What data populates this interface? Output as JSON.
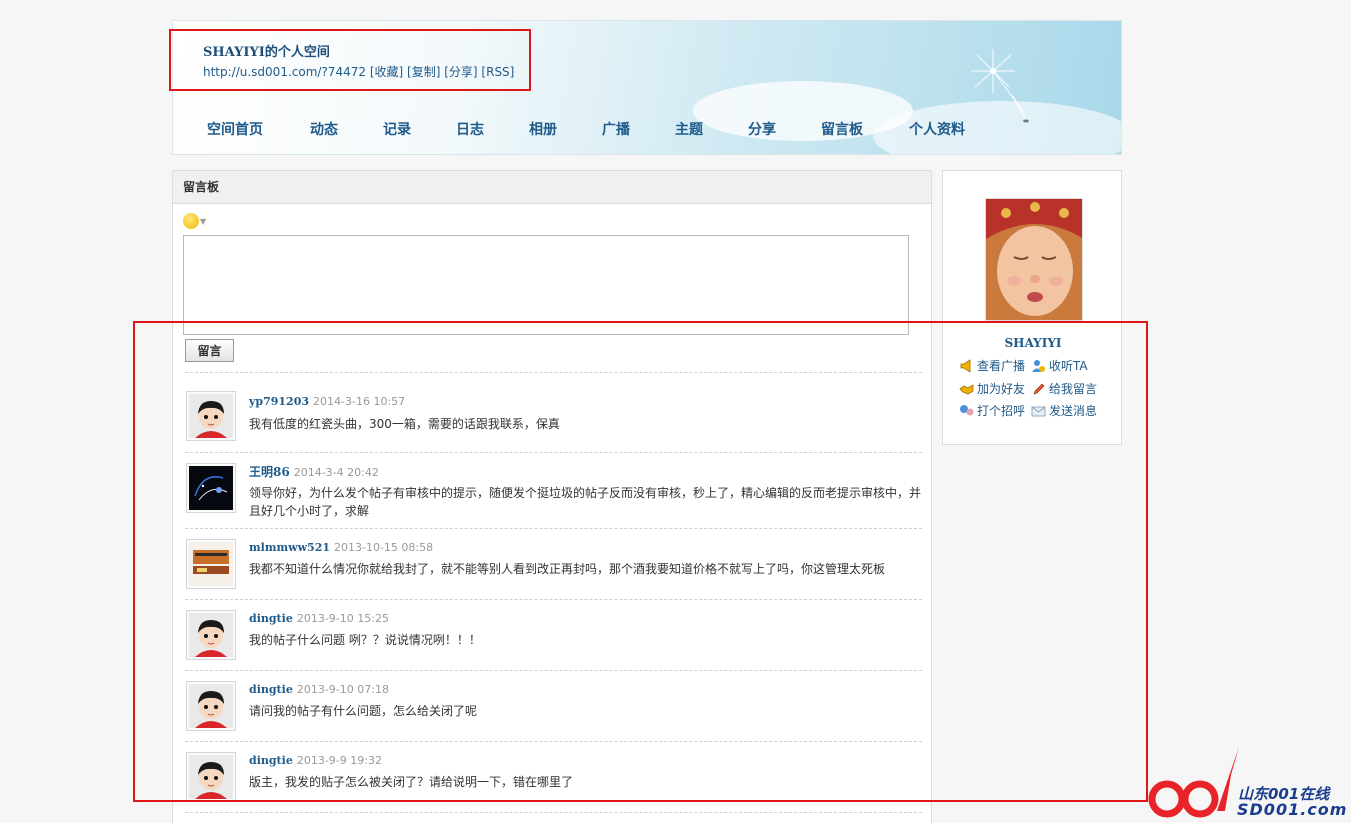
{
  "header": {
    "title": "SHAYIYI的个人空间",
    "url": "http://u.sd001.com/?74472",
    "links": [
      "[收藏]",
      "[复制]",
      "[分享]",
      "[RSS]"
    ]
  },
  "nav": [
    "空间首页",
    "动态",
    "记录",
    "日志",
    "相册",
    "广播",
    "主题",
    "分享",
    "留言板",
    "个人资料"
  ],
  "main": {
    "title": "留言板",
    "submit_label": "留言",
    "comments": [
      {
        "user": "yp791203",
        "time": "2014-3-16 10:57",
        "text": "我有低度的红瓷头曲，300一箱，需要的话跟我联系，保真",
        "avatar": "cartoon-boy"
      },
      {
        "user": "王明86",
        "time": "2014-3-4 20:42",
        "text": "领导你好，为什么发个帖子有审核中的提示，随便发个挺垃圾的帖子反而没有审核，秒上了，精心编辑的反而老提示审核中，并且好几个小时了，求解",
        "avatar": "dark-photo"
      },
      {
        "user": "mlmmww521",
        "time": "2013-10-15 08:58",
        "text": "我都不知道什么情况你就给我封了，就不能等别人看到改正再封吗，那个酒我要知道价格不就写上了吗，你这管理太死板",
        "avatar": "product-photo"
      },
      {
        "user": "dingtie",
        "time": "2013-9-10 15:25",
        "text": "我的帖子什么问题 咧？？说说情况咧！！！",
        "avatar": "cartoon-boy"
      },
      {
        "user": "dingtie",
        "time": "2013-9-10 07:18",
        "text": "请问我的帖子有什么问题，怎么给关闭了呢",
        "avatar": "cartoon-boy"
      },
      {
        "user": "dingtie",
        "time": "2013-9-9 19:32",
        "text": "版主，我发的贴子怎么被关闭了？请给说明一下，错在哪里了",
        "avatar": "cartoon-boy"
      }
    ]
  },
  "sidebar": {
    "name": "SHAYIYI",
    "actions": [
      "查看广播",
      "收听TA",
      "加为好友",
      "给我留言",
      "打个招呼",
      "发送消息"
    ]
  },
  "watermark": {
    "text1": "山东001在线",
    "text2": "SD001.com"
  },
  "colors": {
    "link": "#1f5a8a",
    "annotation": "#e01515"
  }
}
